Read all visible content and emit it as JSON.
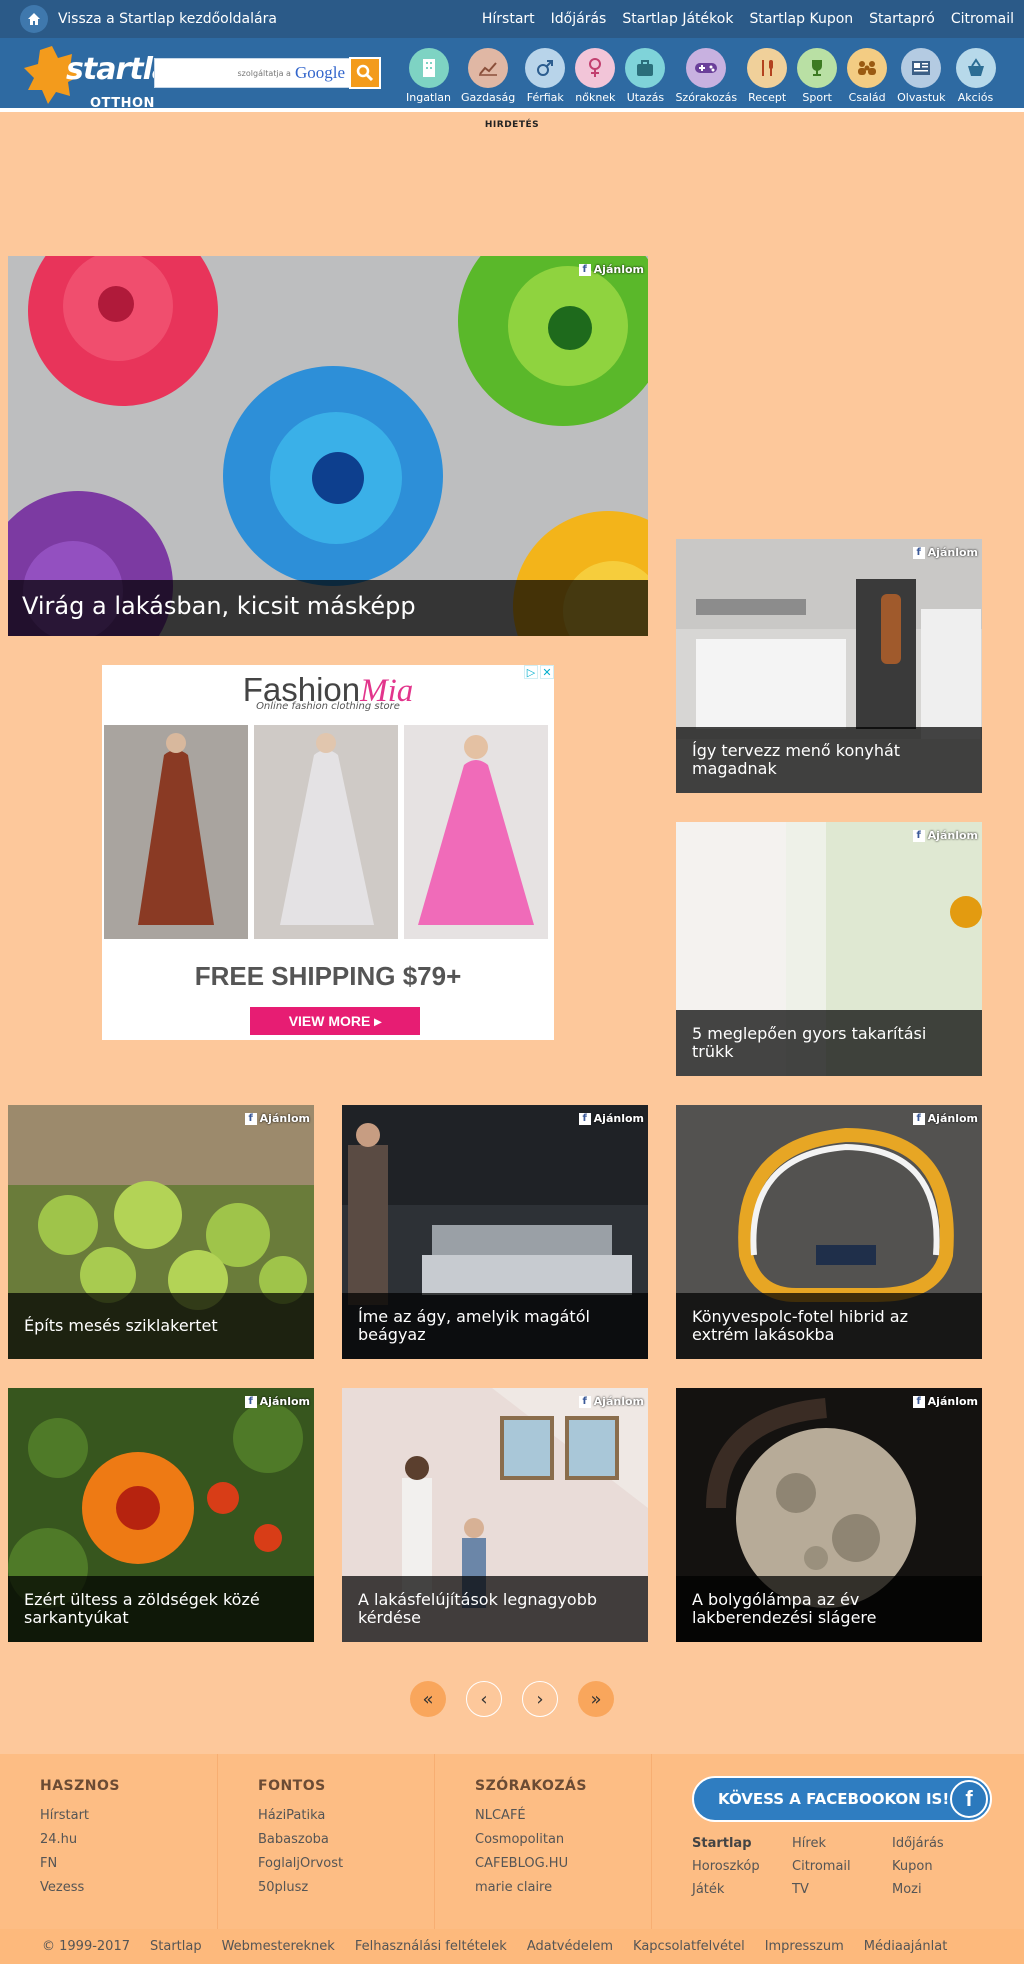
{
  "topbar": {
    "back_label": "Vissza a Startlap kezdőoldalára",
    "links": [
      "Hírstart",
      "Időjárás",
      "Startlap Játékok",
      "Startlap Kupon",
      "Startapró",
      "Citromail"
    ]
  },
  "header": {
    "logo_text": "startlap",
    "logo_sub": "OTTHON",
    "search": {
      "placeholder": "",
      "powered_small": "szolgáltatja a",
      "powered_brand": "Google"
    },
    "categories": [
      {
        "label": "Ingatlan",
        "icon": "building-icon",
        "color": "#7ed3c3"
      },
      {
        "label": "Gazdaság",
        "icon": "chart-icon",
        "color": "#e0b7a4"
      },
      {
        "label": "Férfiak",
        "icon": "male-icon",
        "color": "#b8d4ea"
      },
      {
        "label": "nőknek",
        "icon": "female-icon",
        "color": "#f2c5d8"
      },
      {
        "label": "Utazás",
        "icon": "suitcase-icon",
        "color": "#7fd3d9"
      },
      {
        "label": "Szórakozás",
        "icon": "gamepad-icon",
        "color": "#c8b1e0"
      },
      {
        "label": "Recept",
        "icon": "cutlery-icon",
        "color": "#f0d09a"
      },
      {
        "label": "Sport",
        "icon": "trophy-icon",
        "color": "#b9e0a4"
      },
      {
        "label": "Család",
        "icon": "family-icon",
        "color": "#f3cc83"
      },
      {
        "label": "Olvastuk",
        "icon": "newspaper-icon",
        "color": "#b4cbe2"
      },
      {
        "label": "Akciós",
        "icon": "basket-icon",
        "color": "#b7d9ea"
      }
    ]
  },
  "ad_label": "HIRDETÉS",
  "fb_badge": "Ajánlom",
  "articles": {
    "hero": "Virág a lakásban, kicsit másképp",
    "side1": [
      "Így tervezz menő konyhát",
      "magadnak"
    ],
    "side2": [
      "5 meglepően gyors takarítási",
      "trükk"
    ],
    "row1": [
      [
        "Építs mesés sziklakertet"
      ],
      [
        "Íme az ágy, amelyik magától",
        "beágyaz"
      ],
      [
        "Könyvespolc-fotel hibrid az",
        "extrém lakásokba"
      ]
    ],
    "row2": [
      [
        "Ezért ültess a zöldségek közé",
        "sarkantyúkat"
      ],
      [
        "A lakásfelújítások legnagyobb",
        "kérdése"
      ],
      [
        "A bolygólámpa az év",
        "lakberendezési slágere"
      ]
    ]
  },
  "fashion_ad": {
    "brand_main": "Fashion",
    "brand_script": "Mia",
    "tagline": "Online fashion clothing store",
    "shipping": "FREE SHIPPING $79+",
    "cta": "VIEW MORE ▸",
    "ad_controls": [
      "▷",
      "✕"
    ]
  },
  "pager": [
    "«",
    "‹",
    "›",
    "»"
  ],
  "footer": {
    "col1": {
      "title": "HASZNOS",
      "links": [
        "Hírstart",
        "24.hu",
        "FN",
        "Vezess"
      ]
    },
    "col2": {
      "title": "FONTOS",
      "links": [
        "HáziPatika",
        "Babaszoba",
        "FoglaljOrvost",
        "50plusz"
      ]
    },
    "col3": {
      "title": "SZÓRAKOZÁS",
      "links": [
        "NLCAFÉ",
        "Cosmopolitan",
        "CAFEBLOG.HU",
        "marie claire"
      ]
    },
    "facebook_cta": "KÖVESS A FACEBOOKON IS!",
    "facebook_glyph": "f",
    "grid": [
      {
        "t": "Startlap",
        "bold": true
      },
      {
        "t": "Hírek"
      },
      {
        "t": "Időjárás"
      },
      {
        "t": "Horoszkóp"
      },
      {
        "t": "Citromail"
      },
      {
        "t": "Kupon"
      },
      {
        "t": "Játék"
      },
      {
        "t": "TV"
      },
      {
        "t": "Mozi"
      }
    ]
  },
  "bottombar": [
    "© 1999-2017",
    "Startlap",
    "Webmestereknek",
    "Felhasználási feltételek",
    "Adatvédelem",
    "Kapcsolatfelvétel",
    "Impresszum",
    "Médiaajánlat"
  ]
}
